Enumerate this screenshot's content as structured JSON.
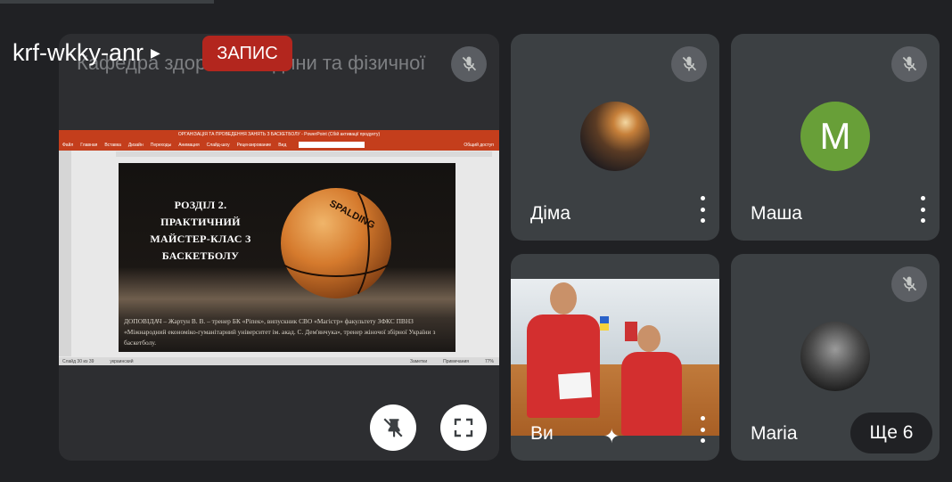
{
  "meeting": {
    "code": "krf-wkky-anr",
    "recording_label": "ЗАПИС"
  },
  "presenter": {
    "name": "Кафедра здоров'я людини та фізичної",
    "ppt_window_title": "ОРГАНІЗАЦІЯ ТА ПРОВЕДЕННЯ ЗАНЯТЬ З БАСКЕТБОЛУ - PowerPoint (Сбій активації продукту)",
    "ppt_tabs": [
      "Файл",
      "Главная",
      "Вставка",
      "Дизайн",
      "Переходы",
      "Анимация",
      "Слайд-шоу",
      "Рецензирование",
      "Вид"
    ],
    "ppt_share": "Общий доступ",
    "slide": {
      "heading": "РОЗДІЛ 2. ПРАКТИЧНИЙ МАЙСТЕР-КЛАС З БАСКЕТБОЛУ",
      "ball_brand": "SPALDING",
      "caption": "ДОПОВІДАЧ – Жартун В. В. – тренер БК «Ріпек», випускник СВО «Магістр» факультету ЗФКС ПВНЗ «Міжнародний економіко-гуманітарний університет ім. акад. С. Дем'янчука», тренер жіночої збірної України з баскетболу."
    },
    "status_left": "Слайд 30 из 39",
    "status_lang": "украинский",
    "status_notes": "Заметки",
    "status_comments": "Примечания",
    "zoom": "77%"
  },
  "participants": [
    {
      "name": "Діма",
      "muted": true
    },
    {
      "name": "Маша",
      "initial": "M",
      "muted": true
    },
    {
      "name": "Ви",
      "muted": false
    },
    {
      "name": "Maria",
      "muted": true
    }
  ],
  "more_participants": "Ще 6",
  "icons": {
    "mic_off": "mic-off-icon",
    "unpin": "unpin-icon",
    "fullscreen": "fullscreen-icon",
    "more": "more-vert-icon",
    "effects": "sparkle-icon"
  },
  "colors": {
    "record": "#b3261e",
    "avatar_masha": "#689f38",
    "ppt_accent": "#c43e1c"
  }
}
